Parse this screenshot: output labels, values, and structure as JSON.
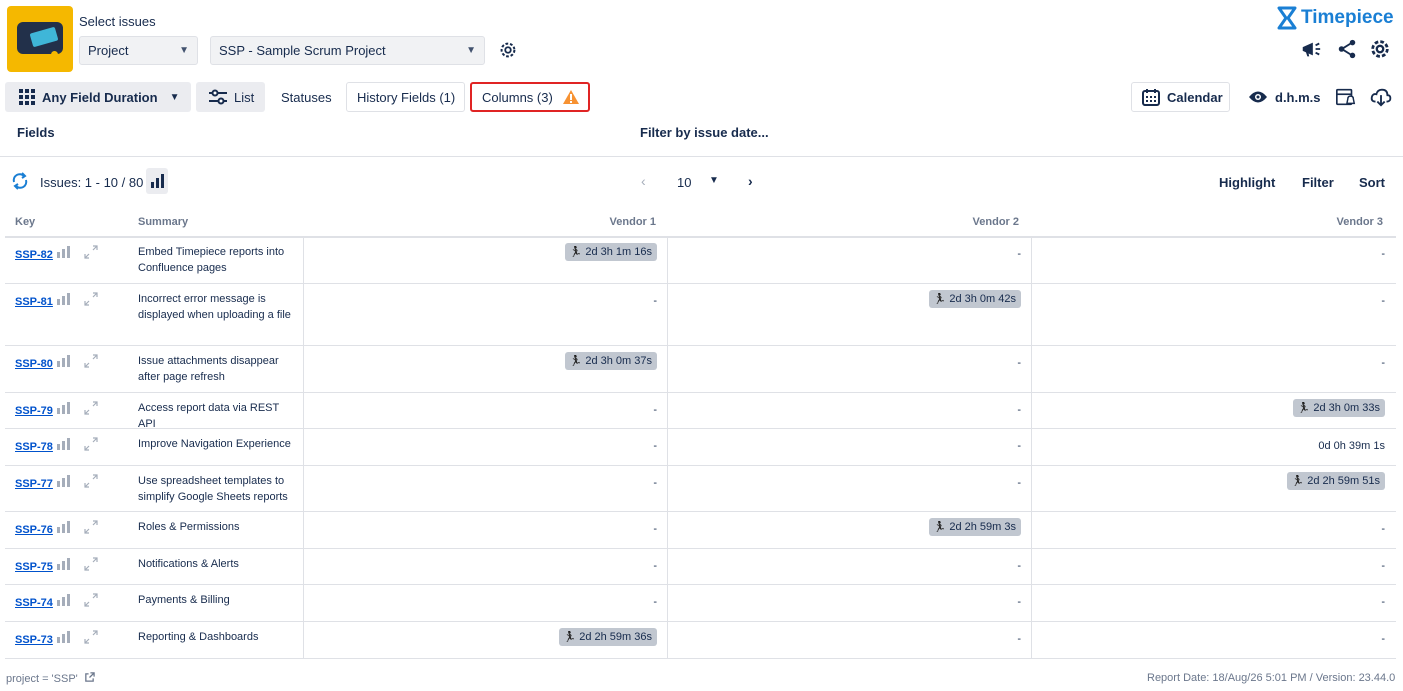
{
  "header": {
    "select_title": "Select issues",
    "project_select": "Project",
    "project_value": "SSP - Sample Scrum Project",
    "brand": "Timepiece"
  },
  "toolbar": {
    "any_field": "Any Field Duration",
    "list": "List",
    "statuses": "Statuses",
    "history_fields": "History Fields (1)",
    "columns": "Columns (3)",
    "calendar": "Calendar",
    "dhms": "d.h.m.s"
  },
  "filters": {
    "fields": "Fields",
    "filter_by_date": "Filter by issue date..."
  },
  "pagination": {
    "issues": "Issues: 1 - 10 / 80",
    "page_size": "10",
    "highlight": "Highlight",
    "filter": "Filter",
    "sort": "Sort"
  },
  "table": {
    "headers": {
      "key": "Key",
      "summary": "Summary",
      "v1": "Vendor 1",
      "v2": "Vendor 2",
      "v3": "Vendor 3"
    },
    "rows": [
      {
        "key": "SSP-82",
        "summary": "Embed Timepiece reports into Confluence pages",
        "v1": "2d 3h 1m 16s",
        "v2": "-",
        "v3": "-"
      },
      {
        "key": "SSP-81",
        "summary": "Incorrect error message is displayed when uploading a file",
        "v1": "-",
        "v2": "2d 3h 0m 42s",
        "v3": "-"
      },
      {
        "key": "SSP-80",
        "summary": "Issue attachments disappear after page refresh",
        "v1": "2d 3h 0m 37s",
        "v2": "-",
        "v3": "-"
      },
      {
        "key": "SSP-79",
        "summary": "Access report data via REST API",
        "v1": "-",
        "v2": "-",
        "v3": "2d 3h 0m 33s"
      },
      {
        "key": "SSP-78",
        "summary": "Improve Navigation Experience",
        "v1": "-",
        "v2": "-",
        "v3": "0d 0h 39m 1s"
      },
      {
        "key": "SSP-77",
        "summary": "Use spreadsheet templates to simplify Google Sheets reports",
        "v1": "-",
        "v2": "-",
        "v3": "2d 2h 59m 51s"
      },
      {
        "key": "SSP-76",
        "summary": "Roles & Permissions",
        "v1": "-",
        "v2": "2d 2h 59m 3s",
        "v3": "-"
      },
      {
        "key": "SSP-75",
        "summary": "Notifications & Alerts",
        "v1": "-",
        "v2": "-",
        "v3": "-"
      },
      {
        "key": "SSP-74",
        "summary": "Payments & Billing",
        "v1": "-",
        "v2": "-",
        "v3": "-"
      },
      {
        "key": "SSP-73",
        "summary": "Reporting & Dashboards",
        "v1": "2d 2h 59m 36s",
        "v2": "-",
        "v3": "-"
      }
    ]
  },
  "footer": {
    "query": "project = 'SSP'",
    "report_info": "Report Date: 18/Aug/26 5:01 PM / Version: 23.44.0"
  },
  "colors": {
    "brand": "#1a7fd4",
    "highlight_border": "#e02424",
    "badge_bg": "#c1c7d0",
    "link": "#0052cc"
  }
}
